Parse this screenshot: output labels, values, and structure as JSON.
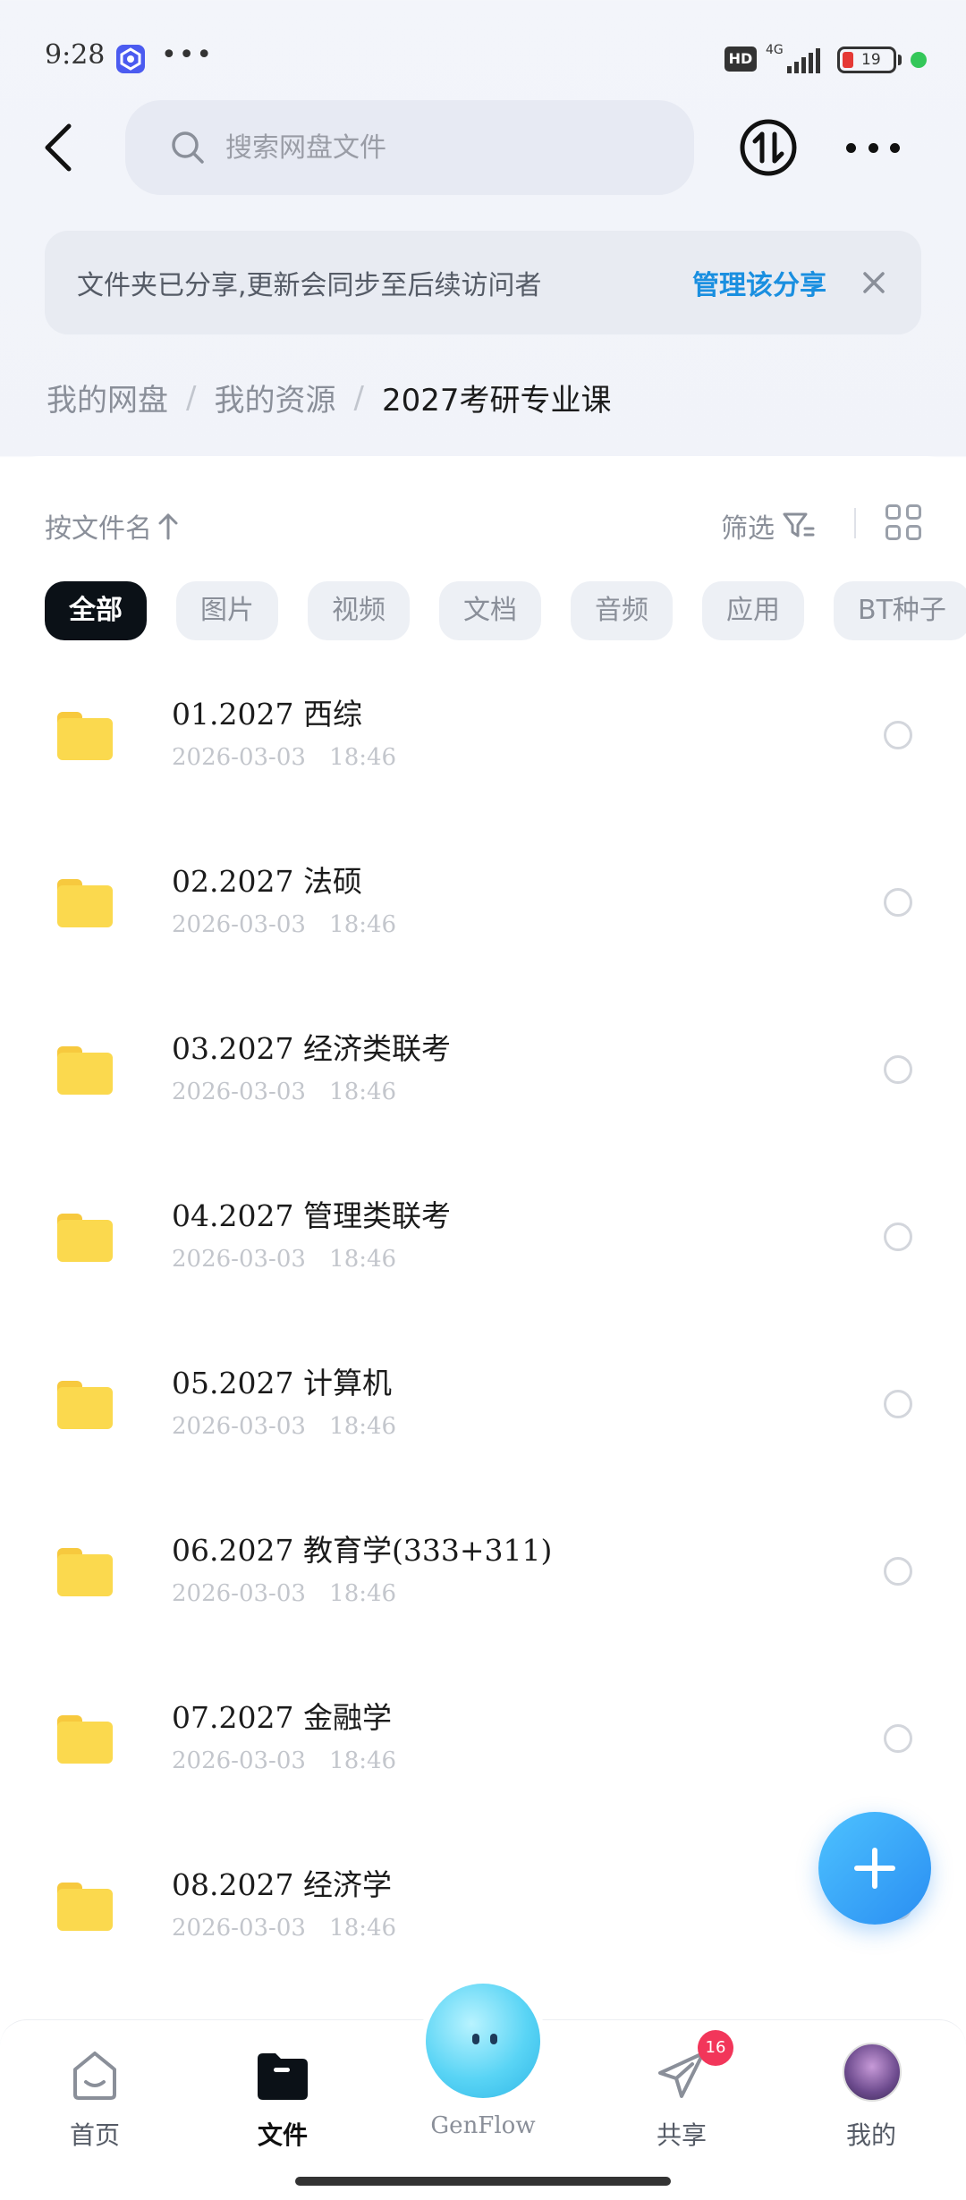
{
  "status_bar": {
    "time": "9:28",
    "dots": "•••",
    "hd": "HD",
    "network": "4G",
    "battery": "19",
    "colors": {
      "battery_low": "#e53935",
      "dot": "#34c759"
    }
  },
  "header": {
    "search_placeholder": "搜索网盘文件"
  },
  "notice": {
    "text": "文件夹已分享,更新会同步至后续访问者",
    "link": "管理该分享"
  },
  "breadcrumb": {
    "items": [
      "我的网盘",
      "我的资源"
    ],
    "current": "2027考研专业课"
  },
  "toolbar": {
    "sort_label": "按文件名",
    "filter_label": "筛选"
  },
  "chips": [
    "全部",
    "图片",
    "视频",
    "文档",
    "音频",
    "应用",
    "BT种子"
  ],
  "files": [
    {
      "name": "01.2027 西综",
      "date": "2026-03-03 18:46"
    },
    {
      "name": "02.2027 法硕",
      "date": "2026-03-03 18:46"
    },
    {
      "name": "03.2027 经济类联考",
      "date": "2026-03-03 18:46"
    },
    {
      "name": "04.2027 管理类联考",
      "date": "2026-03-03 18:46"
    },
    {
      "name": "05.2027 计算机",
      "date": "2026-03-03 18:46"
    },
    {
      "name": "06.2027 教育学(333+311)",
      "date": "2026-03-03 18:46"
    },
    {
      "name": "07.2027 金融学",
      "date": "2026-03-03 18:46"
    },
    {
      "name": "08.2027 经济学",
      "date": "2026-03-03 18:46"
    }
  ],
  "bottom_nav": {
    "home": "首页",
    "files": "文件",
    "genflow": "GenFlow",
    "share": "共享",
    "share_badge": "16",
    "me": "我的"
  },
  "colors": {
    "accent": "#1a8fe0",
    "folder": "#fbd94e",
    "fab": "#2a8ef2"
  }
}
